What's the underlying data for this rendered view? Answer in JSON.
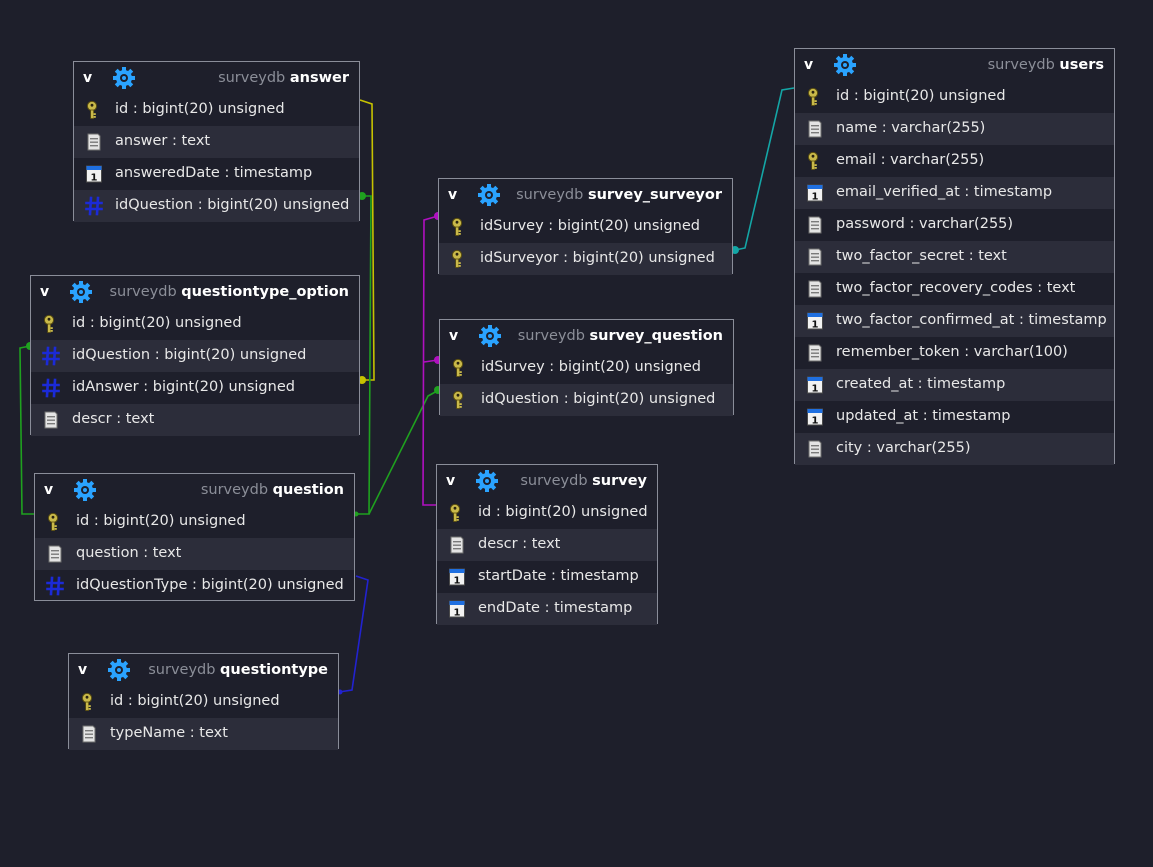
{
  "schema": "surveydb",
  "collapse_label": "v",
  "colors": {
    "background": "#1e1f2b",
    "row_alt": "#2c2d3a",
    "border": "#8a8d99",
    "key_icon": "#c9b94a",
    "text_icon": "#cfcfcf",
    "timestamp_icon": "#1f6fe0",
    "hash_icon": "#1b2ad8",
    "table_icon": "#2aa3ff",
    "connector_yellow": "#c6c200",
    "connector_green": "#1fa11f",
    "connector_magenta": "#b010c0",
    "connector_teal": "#14a6a6",
    "connector_blue": "#2222d0"
  },
  "tables": [
    {
      "key": "answer",
      "name": "answer",
      "columns": [
        {
          "label": "id : bigint(20) unsigned",
          "icon": "key-icon"
        },
        {
          "label": "answer : text",
          "icon": "text-column-icon"
        },
        {
          "label": "answeredDate : timestamp",
          "icon": "timestamp-column-icon"
        },
        {
          "label": "idQuestion : bigint(20) unsigned",
          "icon": "hash-column-icon"
        }
      ]
    },
    {
      "key": "questiontype_option",
      "name": "questiontype_option",
      "columns": [
        {
          "label": "id : bigint(20) unsigned",
          "icon": "key-icon"
        },
        {
          "label": "idQuestion : bigint(20) unsigned",
          "icon": "hash-column-icon"
        },
        {
          "label": "idAnswer : bigint(20) unsigned",
          "icon": "hash-column-icon"
        },
        {
          "label": "descr : text",
          "icon": "text-column-icon"
        }
      ]
    },
    {
      "key": "question",
      "name": "question",
      "columns": [
        {
          "label": "id : bigint(20) unsigned",
          "icon": "key-icon"
        },
        {
          "label": "question : text",
          "icon": "text-column-icon"
        },
        {
          "label": "idQuestionType : bigint(20) unsigned",
          "icon": "hash-column-icon"
        }
      ]
    },
    {
      "key": "questiontype",
      "name": "questiontype",
      "columns": [
        {
          "label": "id : bigint(20) unsigned",
          "icon": "key-icon"
        },
        {
          "label": "typeName : text",
          "icon": "text-column-icon"
        }
      ]
    },
    {
      "key": "survey_surveyor",
      "name": "survey_surveyor",
      "columns": [
        {
          "label": "idSurvey : bigint(20) unsigned",
          "icon": "key-icon"
        },
        {
          "label": "idSurveyor : bigint(20) unsigned",
          "icon": "key-icon"
        }
      ]
    },
    {
      "key": "survey_question",
      "name": "survey_question",
      "columns": [
        {
          "label": "idSurvey : bigint(20) unsigned",
          "icon": "key-icon"
        },
        {
          "label": "idQuestion : bigint(20) unsigned",
          "icon": "key-icon"
        }
      ]
    },
    {
      "key": "survey",
      "name": "survey",
      "columns": [
        {
          "label": "id : bigint(20) unsigned",
          "icon": "key-icon"
        },
        {
          "label": "descr : text",
          "icon": "text-column-icon"
        },
        {
          "label": "startDate : timestamp",
          "icon": "timestamp-column-icon"
        },
        {
          "label": "endDate : timestamp",
          "icon": "timestamp-column-icon"
        }
      ]
    },
    {
      "key": "users",
      "name": "users",
      "columns": [
        {
          "label": "id : bigint(20) unsigned",
          "icon": "key-icon"
        },
        {
          "label": "name : varchar(255)",
          "icon": "text-column-icon"
        },
        {
          "label": "email : varchar(255)",
          "icon": "key-icon"
        },
        {
          "label": "email_verified_at : timestamp",
          "icon": "timestamp-column-icon"
        },
        {
          "label": "password : varchar(255)",
          "icon": "text-column-icon"
        },
        {
          "label": "two_factor_secret : text",
          "icon": "text-column-icon"
        },
        {
          "label": "two_factor_recovery_codes : text",
          "icon": "text-column-icon"
        },
        {
          "label": "two_factor_confirmed_at : timestamp",
          "icon": "timestamp-column-icon"
        },
        {
          "label": "remember_token : varchar(100)",
          "icon": "text-column-icon"
        },
        {
          "label": "created_at : timestamp",
          "icon": "timestamp-column-icon"
        },
        {
          "label": "updated_at : timestamp",
          "icon": "timestamp-column-icon"
        },
        {
          "label": "city : varchar(255)",
          "icon": "text-column-icon"
        }
      ]
    }
  ]
}
